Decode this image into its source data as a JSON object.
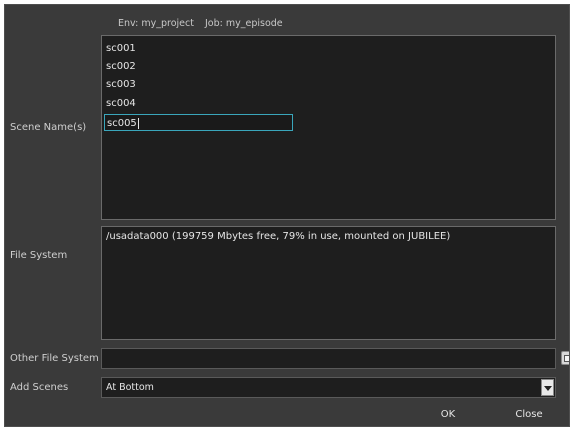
{
  "header": {
    "env": "Env: my_project",
    "job": "Job: my_episode"
  },
  "labels": {
    "scene_names": "Scene Name(s)",
    "file_system": "File System",
    "other_file_system": "Other File System",
    "add_scenes": "Add Scenes"
  },
  "scenes": [
    "sc001",
    "sc002",
    "sc003",
    "sc004"
  ],
  "scene_edit_value": "sc005",
  "file_system_entry": "/usadata000  (199759 Mbytes free, 79% in use, mounted on JUBILEE)",
  "other_file_system_value": "",
  "add_scenes_value": "At Bottom",
  "buttons": {
    "ok": "OK",
    "close": "Close"
  },
  "icons": {
    "browse": "folder-browse-icon",
    "dropdown": "chevron-down-icon"
  },
  "colors": {
    "panel_bg": "#3a3a3a",
    "field_bg": "#1e1e1e",
    "focus_border": "#3aa6bb"
  }
}
